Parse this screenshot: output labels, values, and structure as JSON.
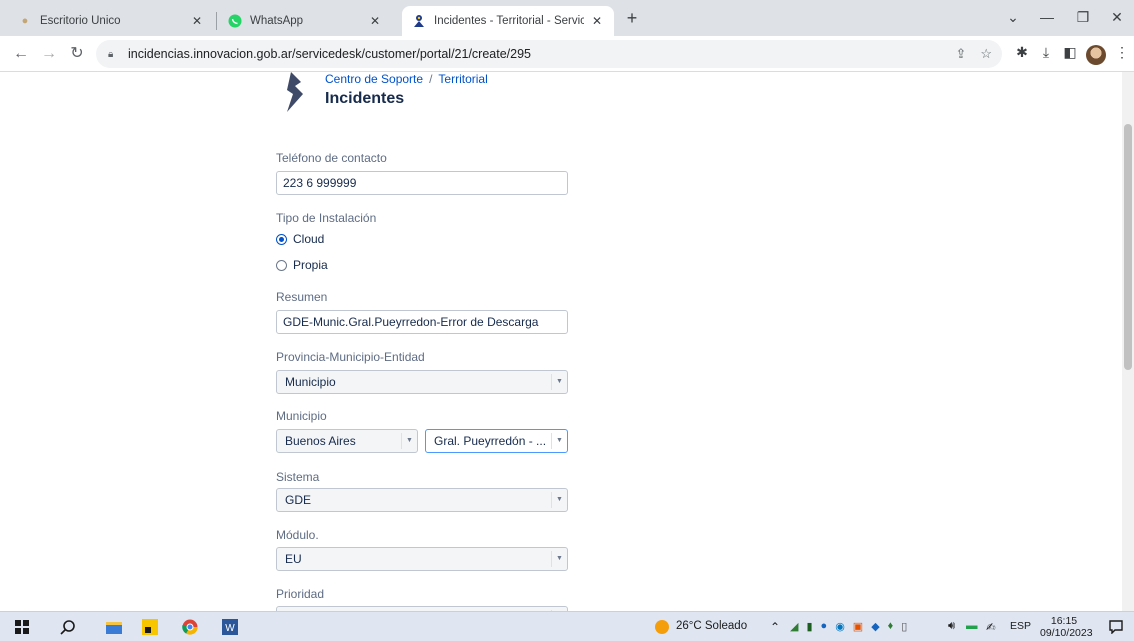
{
  "browser": {
    "tabs": [
      {
        "title": "Escritorio Único",
        "favicon": "page-icon"
      },
      {
        "title": "WhatsApp",
        "favicon": "whatsapp-icon"
      },
      {
        "title": "Incidentes - Territorial - Service",
        "favicon": "servicedesk-icon",
        "active": true
      }
    ],
    "url": "incidencias.innovacion.gob.ar/servicedesk/customer/portal/21/create/295"
  },
  "header": {
    "breadcrumb": [
      "Centro de Soporte",
      "Territorial"
    ],
    "breadcrumb_sep": "/",
    "title": "Incidentes"
  },
  "form": {
    "telefono": {
      "label": "Teléfono de contacto",
      "value": "223 6 999999"
    },
    "tipo_instalacion": {
      "label": "Tipo de Instalación",
      "options": [
        "Cloud",
        "Propia"
      ],
      "selected": "Cloud"
    },
    "resumen": {
      "label": "Resumen",
      "value": "GDE-Munic.Gral.Pueyrredon-Error de Descarga"
    },
    "provincia": {
      "label": "Provincia-Municipio-Entidad",
      "value": "Municipio"
    },
    "municipio": {
      "label": "Municipio",
      "provincia_value": "Buenos Aires",
      "municipio_value": "Gral. Pueyrredón - ..."
    },
    "sistema": {
      "label": "Sistema",
      "value": "GDE"
    },
    "modulo": {
      "label": "Módulo.",
      "value": "EU"
    },
    "prioridad": {
      "label": "Prioridad"
    }
  },
  "taskbar": {
    "weather": "26°C Soleado",
    "language": "ESP",
    "time": "16:15",
    "date": "09/10/2023"
  },
  "colors": {
    "link": "#0052cc",
    "accent": "#4c9aff",
    "logo": "#3e4a67"
  }
}
